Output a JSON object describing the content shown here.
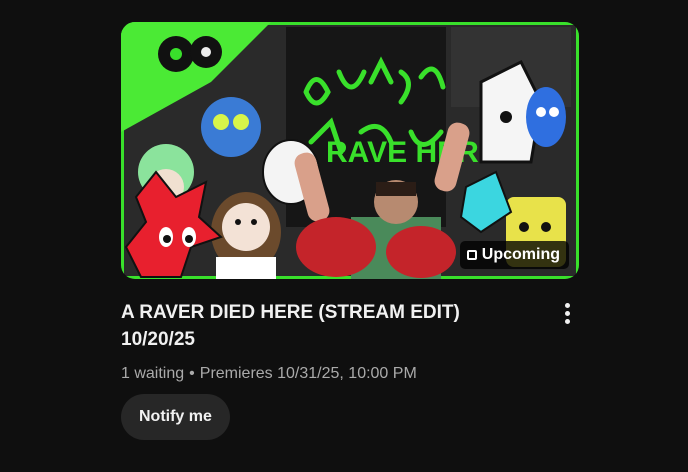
{
  "video": {
    "title": "A RAVER DIED HERE (STREAM EDIT) 10/20/25",
    "badge_label": "Upcoming",
    "waiting_text": "1 waiting",
    "separator": "•",
    "premiere_text": "Premieres 10/31/25, 10:00 PM",
    "notify_label": "Notify me",
    "thumbnail_text": "RAVE HERE"
  },
  "colors": {
    "accent_green": "#39e02b",
    "background": "#0f0f0f",
    "button_bg": "#272727",
    "secondary_text": "#aaaaaa"
  },
  "icons": {
    "menu": "more-vert-icon",
    "badge": "upcoming-icon"
  }
}
